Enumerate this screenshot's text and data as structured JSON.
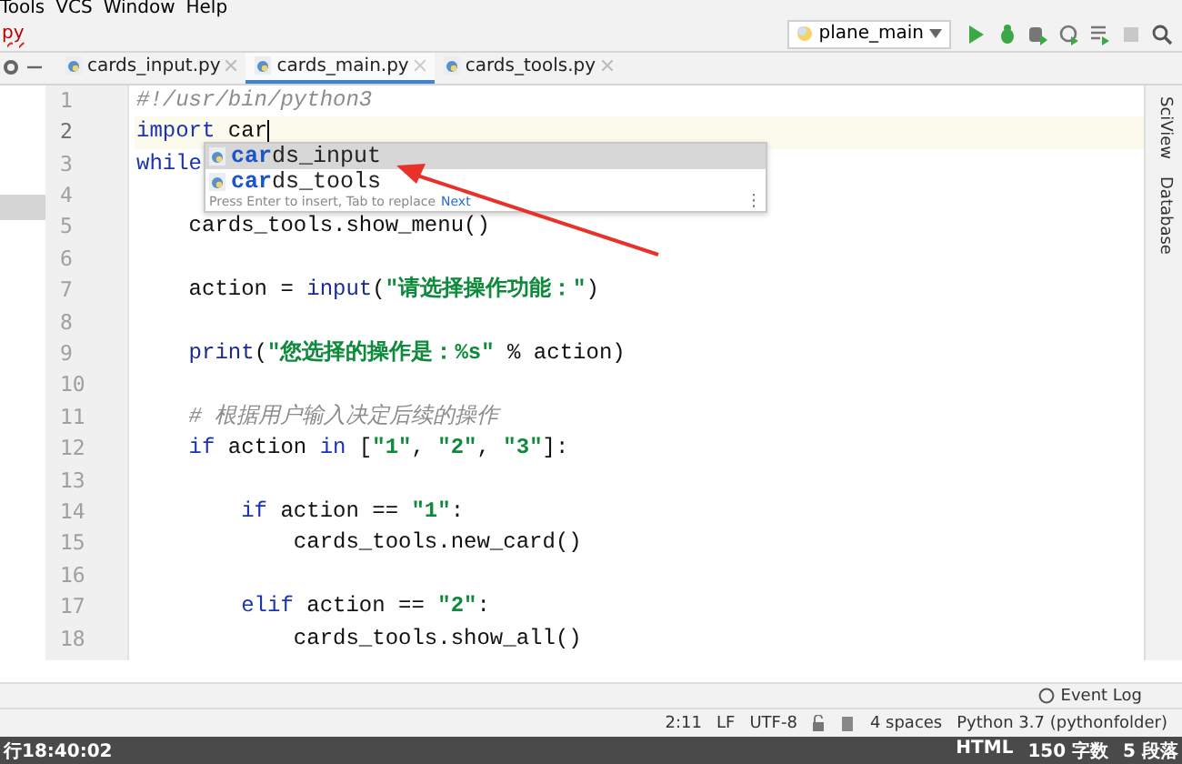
{
  "menu": [
    "Tools",
    "VCS",
    "Window",
    "Help"
  ],
  "breadcrumb": "py",
  "run_config": {
    "label": "plane_main"
  },
  "tabs": [
    {
      "label": "cards_input.py",
      "selected": false
    },
    {
      "label": "cards_main.py",
      "selected": true
    },
    {
      "label": "cards_tools.py",
      "selected": false
    }
  ],
  "side_tools": [
    "SciView",
    "Database"
  ],
  "editor": {
    "lines": [
      {
        "number": "1",
        "current": false,
        "tokens": [
          {
            "text": "#!/usr/bin/python3",
            "kind": "comment"
          }
        ]
      },
      {
        "number": "2",
        "current": true,
        "tokens": [
          {
            "text": "import",
            "kind": "keyword"
          },
          {
            "text": " car",
            "kind": "plain"
          }
        ]
      },
      {
        "number": "3",
        "current": false,
        "tokens": [
          {
            "text": "while",
            "kind": "keyword"
          }
        ]
      },
      {
        "number": "4",
        "current": false
      },
      {
        "number": "5",
        "current": false,
        "tokens": [
          {
            "text": "    cards_tools.show_menu()",
            "kind": "plain"
          }
        ]
      },
      {
        "number": "6",
        "current": false
      },
      {
        "number": "7",
        "current": false,
        "tokens": [
          {
            "text": "    action = ",
            "kind": "plain"
          },
          {
            "text": "input",
            "kind": "builtin"
          },
          {
            "text": "(",
            "kind": "plain"
          },
          {
            "text": "\"请选择操作功能：\"",
            "kind": "string"
          },
          {
            "text": ")",
            "kind": "plain"
          }
        ]
      },
      {
        "number": "8",
        "current": false
      },
      {
        "number": "9",
        "current": false,
        "tokens": [
          {
            "text": "    print",
            "kind": "builtin"
          },
          {
            "text": "(",
            "kind": "plain"
          },
          {
            "text": "\"您选择的操作是：%s\"",
            "kind": "string"
          },
          {
            "text": " % action)",
            "kind": "plain"
          }
        ]
      },
      {
        "number": "10",
        "current": false
      },
      {
        "number": "11",
        "current": false,
        "tokens": [
          {
            "text": "    # 根据用户输入决定后续的操作",
            "kind": "comment"
          }
        ]
      },
      {
        "number": "12",
        "current": false,
        "tokens": [
          {
            "text": "    if",
            "kind": "keyword"
          },
          {
            "text": " action ",
            "kind": "plain"
          },
          {
            "text": "in",
            "kind": "keyword"
          },
          {
            "text": " [",
            "kind": "plain"
          },
          {
            "text": "\"1\"",
            "kind": "string"
          },
          {
            "text": ", ",
            "kind": "plain"
          },
          {
            "text": "\"2\"",
            "kind": "string"
          },
          {
            "text": ", ",
            "kind": "plain"
          },
          {
            "text": "\"3\"",
            "kind": "string"
          },
          {
            "text": "]:",
            "kind": "plain"
          }
        ]
      },
      {
        "number": "13",
        "current": false
      },
      {
        "number": "14",
        "current": false,
        "tokens": [
          {
            "text": "        if",
            "kind": "keyword"
          },
          {
            "text": " action == ",
            "kind": "plain"
          },
          {
            "text": "\"1\"",
            "kind": "string"
          },
          {
            "text": ":",
            "kind": "plain"
          }
        ]
      },
      {
        "number": "15",
        "current": false,
        "tokens": [
          {
            "text": "            cards_tools.new_card()",
            "kind": "plain"
          }
        ]
      },
      {
        "number": "16",
        "current": false
      },
      {
        "number": "17",
        "current": false,
        "tokens": [
          {
            "text": "        elif",
            "kind": "keyword"
          },
          {
            "text": " action == ",
            "kind": "plain"
          },
          {
            "text": "\"2\"",
            "kind": "string"
          },
          {
            "text": ":",
            "kind": "plain"
          }
        ]
      },
      {
        "number": "18",
        "current": false,
        "tokens": [
          {
            "text": "            cards_tools.show_all()",
            "kind": "plain"
          }
        ]
      }
    ]
  },
  "completion": {
    "items": [
      {
        "match": "car",
        "rest": "ds_input",
        "selected": true
      },
      {
        "match": "car",
        "rest": "ds_tools",
        "selected": false
      }
    ],
    "hint": "Press Enter to insert, Tab to replace",
    "hint_link": "Next",
    "more": "⋮"
  },
  "event_log": "Event Log",
  "status": [
    "2:11",
    "LF",
    "UTF-8",
    "4 spaces",
    "Python 3.7 (pythonfolder)"
  ],
  "taskbar": {
    "left": "行18:40:02",
    "right": [
      "HTML",
      "150 字数",
      "5 段落"
    ]
  }
}
